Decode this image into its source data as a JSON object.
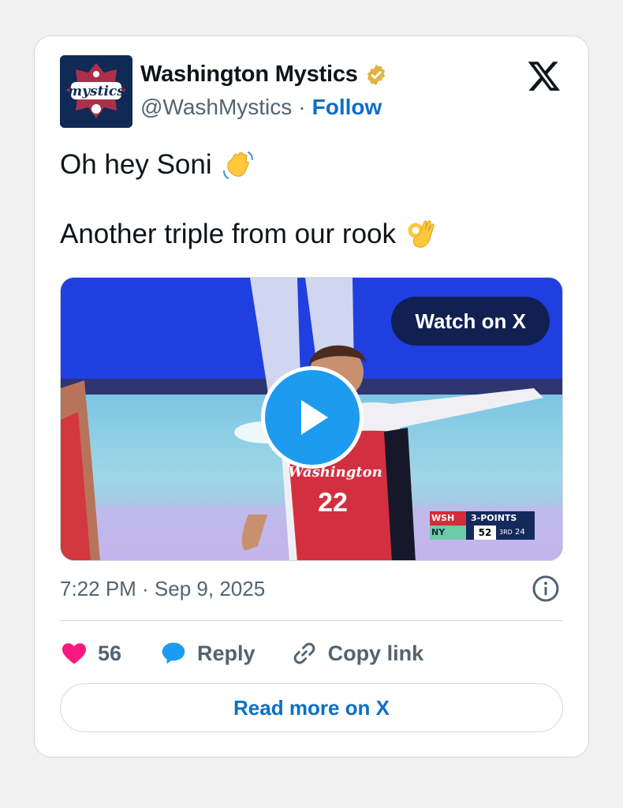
{
  "author": {
    "name": "Washington Mystics",
    "handle": "@WashMystics",
    "separator": "·",
    "follow_label": "Follow",
    "avatar_text": "mystics",
    "verified_icon": "verified-gold-badge-icon"
  },
  "tweet": {
    "lines": [
      {
        "text": "Oh hey Soni",
        "emoji": "waving-hand-icon"
      },
      {
        "text": "Another triple from our rook",
        "emoji": "ok-hand-icon"
      }
    ]
  },
  "media": {
    "watch_label": "Watch on X",
    "play_icon": "play-icon",
    "jersey_text": "Washington",
    "jersey_number": "22",
    "scorebug": {
      "team1": "WSH",
      "team2": "NY",
      "label": "3-POINTS",
      "score": "52",
      "period": "3RD",
      "clock": "24"
    }
  },
  "timestamp": "7:22 PM · Sep 9, 2025",
  "actions": {
    "like_count": "56",
    "reply_label": "Reply",
    "copy_label": "Copy link"
  },
  "read_more_label": "Read more on X",
  "colors": {
    "link_blue": "#0b6fc7",
    "like_pink": "#f91880",
    "reply_blue": "#1d9bf0",
    "muted": "#536471",
    "avatar_navy": "#0f2a55"
  }
}
